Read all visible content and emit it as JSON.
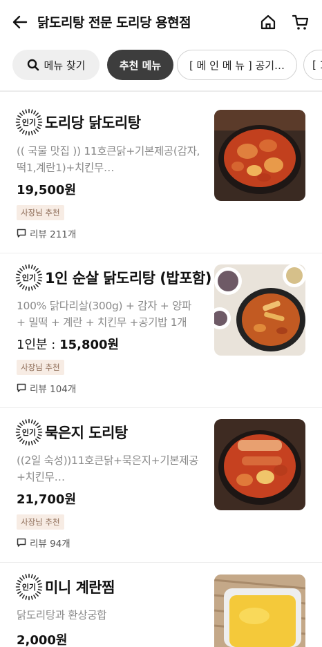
{
  "header": {
    "title": "닭도리탕 전문 도리당 용현점"
  },
  "chips": [
    {
      "label": "메뉴 찾기",
      "icon": "search-icon"
    },
    {
      "label": "추천 메뉴",
      "active": true
    },
    {
      "label": "[ 메 인 메 뉴 ] 공기…"
    },
    {
      "label": "[ 1"
    }
  ],
  "badge_text": "인기",
  "items": [
    {
      "name": "도리당 닭도리탕",
      "description": "(( 국물 맛집 )) 11호큰닭+기본제공(감자,떡1,계란1)+치킨무…",
      "price_prefix": "",
      "price": "19,500원",
      "tag": "사장님 추천",
      "reviews": "리뷰 211개"
    },
    {
      "name": "1인 순살 닭도리탕 (밥포함)",
      "description": "100% 닭다리살(300g) + 감자 + 양파 + 밀떡 + 계란 + 치킨무 +공기밥 1개",
      "price_prefix": "1인분 : ",
      "price": "15,800원",
      "tag": "사장님 추천",
      "reviews": "리뷰 104개"
    },
    {
      "name": "묵은지 도리탕",
      "description": "((2일 숙성))11호큰닭+묵은지+기본제공+치킨무…",
      "price_prefix": "",
      "price": "21,700원",
      "tag": "사장님 추천",
      "reviews": "리뷰 94개"
    },
    {
      "name": "미니 계란찜",
      "description": "닭도리탕과 환상궁합",
      "price_prefix": "",
      "price": "2,000원",
      "tag": "",
      "reviews": ""
    }
  ],
  "colors": {
    "active_chip": "#3d3d3d",
    "tag_bg": "#f7ece4",
    "tag_text": "#8c6a55",
    "desc_text": "#8a8a8a"
  }
}
